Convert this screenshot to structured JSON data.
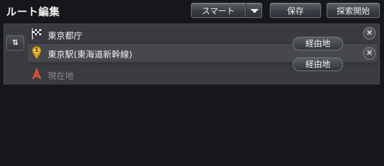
{
  "header": {
    "title": "ルート編集",
    "smart_label": "スマート",
    "save_label": "保存",
    "search_start_label": "探索開始"
  },
  "route": {
    "swap_label": "⇅",
    "points": [
      {
        "name": "東京都庁",
        "type": "destination"
      },
      {
        "name": "東京駅(東海道新幹線)",
        "type": "waypoint",
        "marker_number": "1"
      },
      {
        "name": "現在地",
        "type": "current-location"
      }
    ],
    "via_label": "経由地",
    "close_symbol": "✕"
  },
  "colors": {
    "background": "#16171a",
    "panel": "#3a3b3f",
    "waypoint_marker": "#d6a21e",
    "current_location_marker": "#d9442f"
  }
}
